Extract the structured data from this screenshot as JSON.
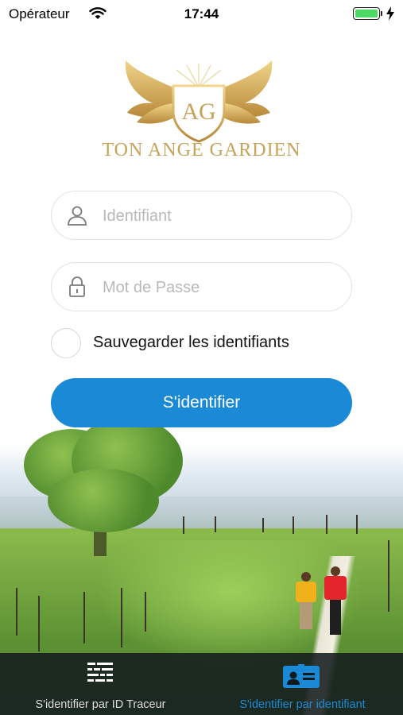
{
  "status_bar": {
    "carrier": "Opérateur",
    "time": "17:44",
    "battery_color": "#4cd964"
  },
  "logo": {
    "monogram": "AG",
    "name": "TON ANGE GARDIEN",
    "color": "#c7a35a"
  },
  "form": {
    "username": {
      "placeholder": "Identifiant",
      "value": "",
      "icon": "user-icon"
    },
    "password": {
      "placeholder": "Mot de Passe",
      "value": "",
      "icon": "lock-icon"
    },
    "remember": {
      "label": "Sauvegarder les identifiants",
      "checked": false
    },
    "submit_label": "S'identifier"
  },
  "tabs": [
    {
      "label": "S'identifier par ID Traceur",
      "icon": "tracker-grid-icon",
      "active": false
    },
    {
      "label": "S'identifier par identifiant",
      "icon": "id-card-icon",
      "active": true
    }
  ],
  "colors": {
    "accent": "#1b8ad6",
    "tab_inactive": "#dcdcdc",
    "tabbar_bg": "#141c1e"
  }
}
